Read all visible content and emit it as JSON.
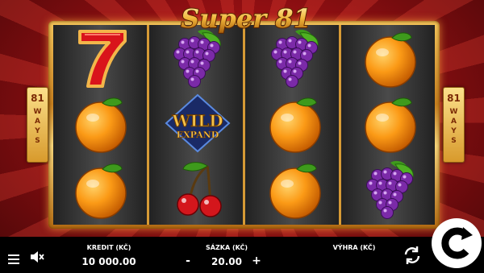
{
  "game": {
    "title": "Super 81"
  },
  "ways": {
    "number": "81",
    "label": "WAYS"
  },
  "wild": {
    "line1": "WILD",
    "line2": "EXPAND"
  },
  "reels": [
    [
      "seven",
      "orange",
      "orange"
    ],
    [
      "grapes",
      "wild",
      "cherries"
    ],
    [
      "grapes",
      "orange",
      "orange"
    ],
    [
      "orange",
      "orange",
      "grapes"
    ]
  ],
  "bottom": {
    "kredit_label": "KREDIT (KČ)",
    "kredit_value": "10 000.00",
    "sazka_label": "SÁZKA (KČ)",
    "sazka_value": "20.00",
    "minus": "-",
    "plus": "+",
    "vyhra_label": "VÝHRA (KČ)"
  },
  "icons": [
    "menu-icon",
    "sound-muted-icon",
    "autoplay-icon",
    "spin-icon"
  ],
  "colors": {
    "background": "#9c1214",
    "frame_gold": "#e0a73f",
    "bar": "#000000",
    "ways_badge": "#f3c962"
  }
}
